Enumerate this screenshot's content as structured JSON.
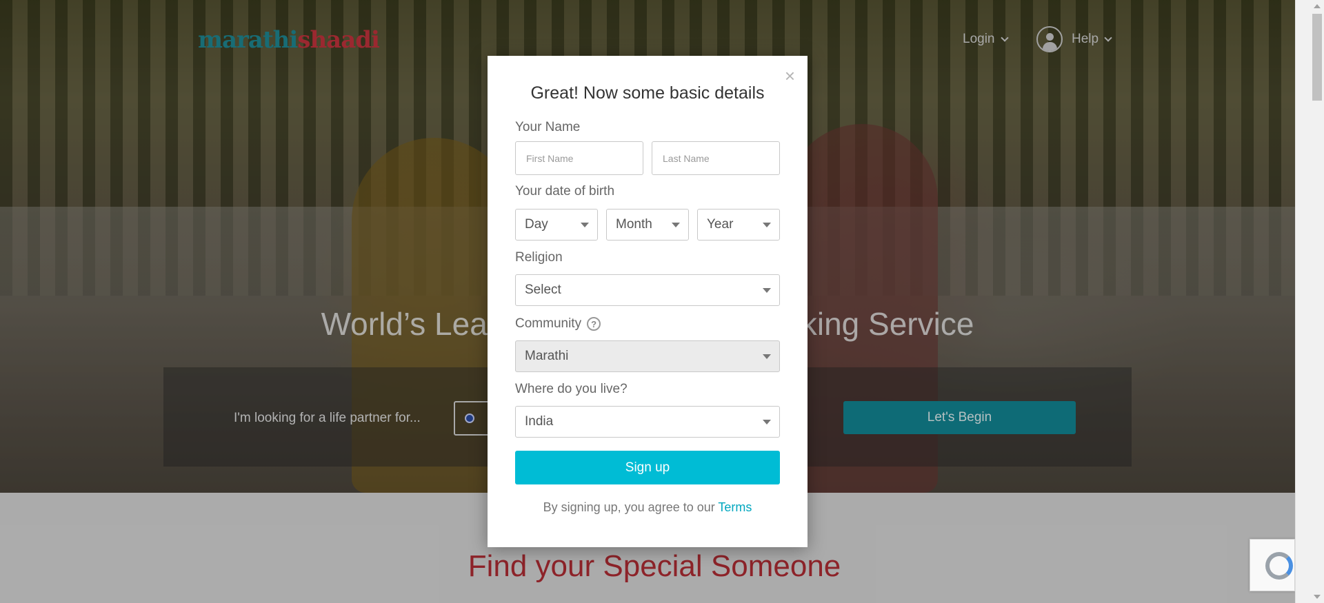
{
  "header": {
    "logo_part1": "marathi",
    "logo_part2": "shaadi",
    "login_label": "Login",
    "help_label": "Help"
  },
  "hero": {
    "title": "World’s Leading Marathi Matchmaking Service",
    "looking_label": "I'm looking for a life partner for...",
    "begin_label": "Let's Begin"
  },
  "lower": {
    "heading": "Find your Special Someone"
  },
  "modal": {
    "title": "Great! Now some basic details",
    "close_glyph": "×",
    "name_label": "Your Name",
    "first_name_placeholder": "First Name",
    "last_name_placeholder": "Last Name",
    "dob_label": "Your date of birth",
    "day_value": "Day",
    "month_value": "Month",
    "year_value": "Year",
    "religion_label": "Religion",
    "religion_value": "Select",
    "community_label": "Community",
    "community_help": "?",
    "community_value": "Marathi",
    "live_label": "Where do you live?",
    "live_value": "India",
    "signup_label": "Sign up",
    "terms_text": "By signing up, you agree to our ",
    "terms_link": "Terms"
  },
  "colors": {
    "accent": "#00bcd5",
    "brand_teal": "#1f8b96",
    "brand_red": "#c7343e",
    "heading_red": "#b52d35"
  },
  "icons": [
    "close-icon",
    "chevron-down-icon",
    "user-avatar-icon",
    "help-icon",
    "dropdown-caret-icon",
    "recaptcha-icon"
  ]
}
